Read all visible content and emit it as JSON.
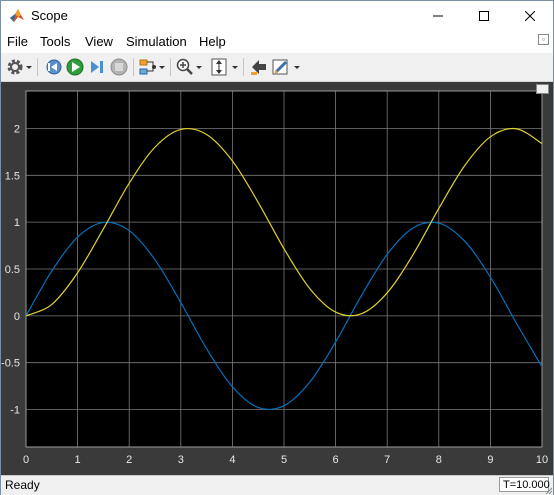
{
  "window": {
    "title": "Scope",
    "icon": "matlab-logo-icon",
    "controls": [
      "minimize-icon",
      "maximize-icon",
      "close-icon"
    ]
  },
  "menu": [
    "File",
    "Tools",
    "View",
    "Simulation",
    "Help"
  ],
  "toolbar": {
    "icons": [
      "gear-icon",
      "step-back-icon",
      "run-icon",
      "step-forward-icon",
      "stop-icon",
      "signal-select-icon",
      "zoom-in-icon",
      "scale-y-axis-icon",
      "highlight-block-icon",
      "edit-style-icon"
    ]
  },
  "colors": {
    "plot_background": "#000000",
    "axes_frame": "#3a3a3a",
    "grid": "#7a7a7a",
    "series_1": "#0072bd",
    "series_2": "#dfd32b"
  },
  "chart_data": {
    "type": "line",
    "title": "",
    "xlabel": "",
    "ylabel": "",
    "xlim": [
      0,
      10
    ],
    "ylim": [
      -1.4,
      2.4
    ],
    "grid": true,
    "legend": "none",
    "x_ticks": [
      "0",
      "1",
      "2",
      "3",
      "4",
      "5",
      "6",
      "7",
      "8",
      "9",
      "10"
    ],
    "y_ticks": [
      "-1",
      "-0.5",
      "0",
      "0.5",
      "1",
      "1.5",
      "2"
    ],
    "series": [
      {
        "color": "#0072bd",
        "x": [
          0,
          0.5,
          1,
          1.5,
          2,
          2.5,
          3,
          3.5,
          4,
          4.5,
          5,
          5.5,
          6,
          6.5,
          7,
          7.5,
          8,
          8.5,
          9,
          9.5,
          10
        ],
        "y": [
          0,
          0.479,
          0.841,
          0.997,
          0.909,
          0.598,
          0.141,
          -0.351,
          -0.757,
          -0.978,
          -0.959,
          -0.706,
          -0.279,
          0.215,
          0.657,
          0.938,
          0.989,
          0.798,
          0.412,
          -0.075,
          -0.544
        ]
      },
      {
        "color": "#dfd32b",
        "x": [
          0,
          0.5,
          1,
          1.5,
          2,
          2.5,
          3,
          3.5,
          4,
          4.5,
          5,
          5.5,
          6,
          6.5,
          7,
          7.5,
          8,
          8.5,
          9,
          9.5,
          10
        ],
        "y": [
          0,
          0.122,
          0.46,
          0.929,
          1.416,
          1.801,
          1.99,
          1.936,
          1.654,
          1.211,
          0.716,
          0.291,
          0.04,
          0.023,
          0.246,
          0.653,
          1.146,
          1.602,
          1.911,
          1.997,
          1.839
        ]
      }
    ]
  },
  "status": {
    "text": "Ready",
    "time": "T=10.000"
  }
}
